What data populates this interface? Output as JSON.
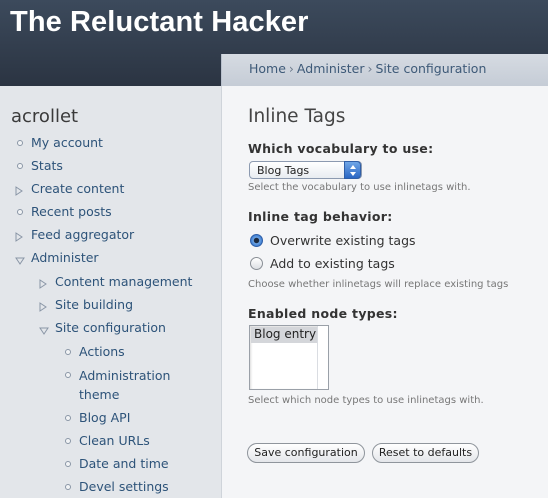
{
  "header": {
    "site_title": "The Reluctant Hacker"
  },
  "breadcrumb": [
    "Home",
    "Administer",
    "Site configuration"
  ],
  "sidebar": {
    "user_name": "acrollet",
    "items": [
      {
        "label": "My account",
        "icon": "circle-bullet-icon"
      },
      {
        "label": "Stats",
        "icon": "circle-bullet-icon"
      },
      {
        "label": "Create content",
        "icon": "triangle-right-icon"
      },
      {
        "label": "Recent posts",
        "icon": "circle-bullet-icon"
      },
      {
        "label": "Feed aggregator",
        "icon": "triangle-right-icon"
      },
      {
        "label": "Administer",
        "icon": "triangle-down-icon"
      },
      {
        "label": "Content management",
        "icon": "triangle-right-icon"
      },
      {
        "label": "Site building",
        "icon": "triangle-right-icon"
      },
      {
        "label": "Site configuration",
        "icon": "triangle-down-icon"
      },
      {
        "label": "Actions",
        "icon": "circle-bullet-icon"
      },
      {
        "label": "Administration theme",
        "icon": "circle-bullet-icon"
      },
      {
        "label": "Blog API",
        "icon": "circle-bullet-icon"
      },
      {
        "label": "Clean URLs",
        "icon": "circle-bullet-icon"
      },
      {
        "label": "Date and time",
        "icon": "circle-bullet-icon"
      },
      {
        "label": "Devel settings",
        "icon": "circle-bullet-icon"
      }
    ]
  },
  "main": {
    "title": "Inline Tags",
    "vocabulary": {
      "label": "Which vocabulary to use:",
      "selected": "Blog Tags",
      "description": "Select the vocabulary to use inlinetags with."
    },
    "behavior": {
      "label": "Inline tag behavior:",
      "options": [
        "Overwrite existing tags",
        "Add to existing tags"
      ],
      "selected_index": 0,
      "description": "Choose whether inlinetags will replace existing tags"
    },
    "node_types": {
      "label": "Enabled node types:",
      "options": [
        "Blog entry"
      ],
      "description": "Select which node types to use inlinetags with."
    },
    "buttons": {
      "save": "Save configuration",
      "reset": "Reset to defaults"
    }
  }
}
